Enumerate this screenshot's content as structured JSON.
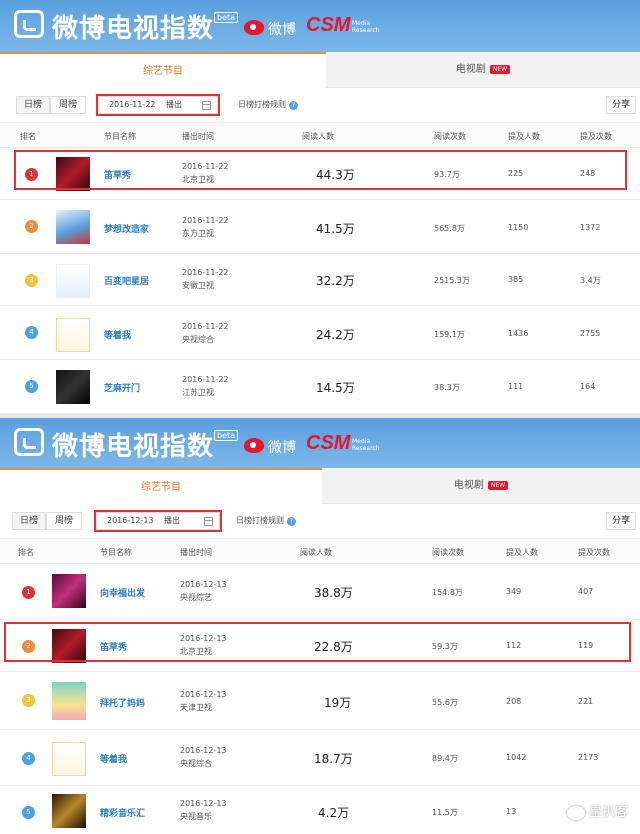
{
  "header": {
    "title": "微博电视指数",
    "beta": "beta",
    "weibo": "微博",
    "csm": "CSM",
    "csm_sub": "Media Research"
  },
  "tabs": {
    "variety": "综艺节目",
    "drama": "电视剧",
    "new_badge": "NEW"
  },
  "filters": {
    "daily": "日榜",
    "weekly": "周榜",
    "broadcast": "播出",
    "rules": "日榜打榜规则",
    "share": "分享"
  },
  "columns": {
    "rank": "排名",
    "name": "节目名称",
    "airtime": "播出时间",
    "readers": "阅读人数",
    "reads": "阅读次数",
    "mention_users": "提及人数",
    "mentions": "提及次数"
  },
  "colors": {
    "rank1": "#d9343a",
    "rank2": "#f08c3c",
    "rank3": "#f5c23c",
    "rank4": "#4aa3df",
    "rank5": "#4aa3df",
    "highlight": "#d9343a"
  },
  "panels": [
    {
      "date": "2016-11-22",
      "rows": [
        {
          "rank": "1",
          "name": "笛草秀",
          "date": "2016-11-22",
          "channel": "北京卫视",
          "readers": "44.3万",
          "reads": "93.7万",
          "mention_users": "225",
          "mentions": "248"
        },
        {
          "rank": "2",
          "name": "梦想改造家",
          "date": "2016-11-22",
          "channel": "东方卫视",
          "readers": "41.5万",
          "reads": "565.8万",
          "mention_users": "1150",
          "mentions": "1372"
        },
        {
          "rank": "3",
          "name": "百变吧星居",
          "date": "2016-11-22",
          "channel": "安徽卫视",
          "readers": "32.2万",
          "reads": "2515.3万",
          "mention_users": "385",
          "mentions": "3.4万"
        },
        {
          "rank": "4",
          "name": "等着我",
          "date": "2016-11-22",
          "channel": "央视综合",
          "readers": "24.2万",
          "reads": "159.1万",
          "mention_users": "1436",
          "mentions": "2755"
        },
        {
          "rank": "5",
          "name": "芝麻开门",
          "date": "2016-11-22",
          "channel": "江苏卫视",
          "readers": "14.5万",
          "reads": "38.3万",
          "mention_users": "111",
          "mentions": "164"
        }
      ]
    },
    {
      "date": "2016-12-13",
      "rows": [
        {
          "rank": "1",
          "name": "向幸福出发",
          "date": "2016-12-13",
          "channel": "央视综艺",
          "readers": "38.8万",
          "reads": "154.8万",
          "mention_users": "349",
          "mentions": "407"
        },
        {
          "rank": "2",
          "name": "笛草秀",
          "date": "2016-12-13",
          "channel": "北京卫视",
          "readers": "22.8万",
          "reads": "59.3万",
          "mention_users": "112",
          "mentions": "119"
        },
        {
          "rank": "3",
          "name": "拜托了妈妈",
          "date": "2016-12-13",
          "channel": "天津卫视",
          "readers": "19万",
          "reads": "55.6万",
          "mention_users": "208",
          "mentions": "221"
        },
        {
          "rank": "4",
          "name": "等着我",
          "date": "2016-12-13",
          "channel": "央视综合",
          "readers": "18.7万",
          "reads": "89.4万",
          "mention_users": "1042",
          "mentions": "2173"
        },
        {
          "rank": "5",
          "name": "精彩音乐汇",
          "date": "2016-12-13",
          "channel": "央视音乐",
          "readers": "4.2万",
          "reads": "11.5万",
          "mention_users": "13",
          "mentions": ""
        }
      ]
    }
  ],
  "watermark": "星扒客"
}
